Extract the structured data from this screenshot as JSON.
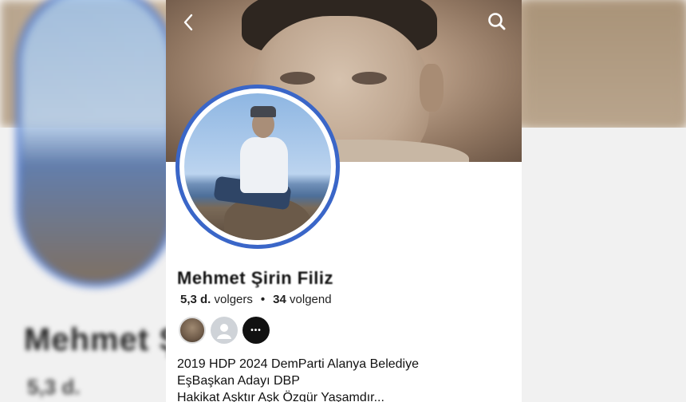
{
  "profile": {
    "name": "Mehmet Şirin Filiz",
    "followers_count": "5,3 d.",
    "followers_label": "volgers",
    "following_count": "34",
    "following_label": "volgend",
    "bio_lines": [
      "2019 HDP 2024 DemParti Alanya Belediye",
      "EşBaşkan Adayı DBP",
      "Hakikat Aşktır Aşk Özgür Yaşamdır..."
    ]
  },
  "icons": {
    "back": "chevron-left-icon",
    "search": "search-icon",
    "more": "more-horizontal-icon",
    "more_glyph": "•••"
  },
  "colors": {
    "ring": "#3a66c8"
  }
}
